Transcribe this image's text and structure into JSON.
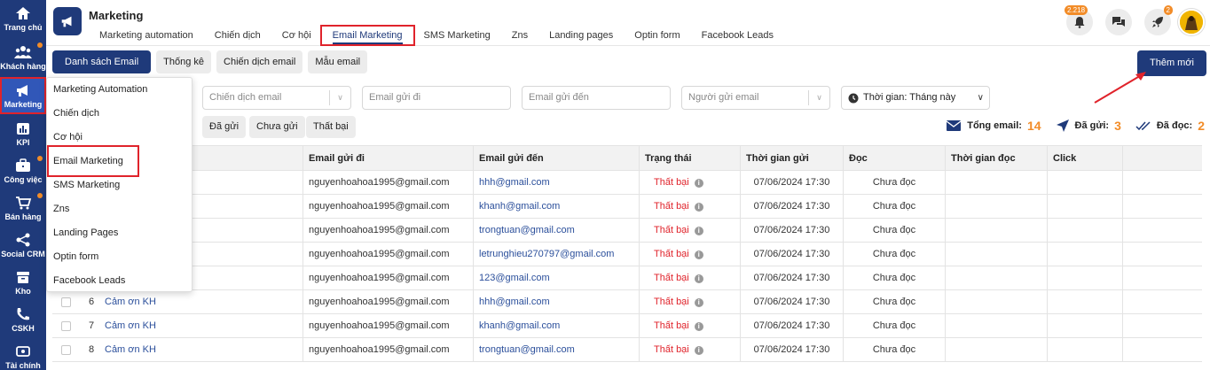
{
  "sidebar": {
    "items": [
      {
        "label": "Trang chủ",
        "icon": "home-icon"
      },
      {
        "label": "Khách hàng",
        "icon": "users-icon",
        "dot": true
      },
      {
        "label": "Marketing",
        "icon": "megaphone-icon",
        "active": true
      },
      {
        "label": "KPI",
        "icon": "chart-icon"
      },
      {
        "label": "Công việc",
        "icon": "briefcase-icon",
        "dot": true
      },
      {
        "label": "Bán hàng",
        "icon": "cart-icon",
        "dot": true
      },
      {
        "label": "Social CRM",
        "icon": "share-icon"
      },
      {
        "label": "Kho",
        "icon": "box-icon"
      },
      {
        "label": "CSKH",
        "icon": "phone-icon"
      },
      {
        "label": "Tài chính",
        "icon": "finance-icon"
      }
    ]
  },
  "header": {
    "title": "Marketing",
    "tabs": [
      "Marketing automation",
      "Chiến dịch",
      "Cơ hội",
      "Email Marketing",
      "SMS Marketing",
      "Zns",
      "Landing pages",
      "Optin form",
      "Facebook Leads"
    ],
    "active_tab": "Email Marketing",
    "notification_count": "2.218",
    "rocket_badge": "2"
  },
  "subtabs": [
    "Danh sách Email",
    "Thống kê",
    "Chiến dịch email",
    "Mẫu email"
  ],
  "add_button": "Thêm mới",
  "filters": {
    "campaign_placeholder": "Chiến dịch email",
    "from_placeholder": "Email gửi đi",
    "to_placeholder": "Email gửi đến",
    "sender_placeholder": "Người gửi email",
    "time_value": "Thời gian: Tháng này"
  },
  "status_chips": [
    "Đã gửi",
    "Chưa gửi",
    "Thất bại"
  ],
  "summary": {
    "total_label": "Tổng email:",
    "total": "14",
    "sent_label": "Đã gửi:",
    "sent": "3",
    "read_label": "Đã đọc:",
    "read": "2"
  },
  "dropdown_menu": [
    "Marketing Automation",
    "Chiến dịch",
    "Cơ hội",
    "Email Marketing",
    "SMS Marketing",
    "Zns",
    "Landing Pages",
    "Optin form",
    "Facebook Leads"
  ],
  "table": {
    "columns": [
      "Email gửi đi",
      "Email gửi đến",
      "Trạng thái",
      "Thời gian gửi",
      "Đọc",
      "Thời gian đọc",
      "Click"
    ],
    "rows": [
      {
        "idx": "",
        "name": "",
        "from": "nguyenhoahoa1995@gmail.com",
        "to": "hhh@gmail.com",
        "status": "Thất bại",
        "sent_time": "07/06/2024 17:30",
        "read": "Chưa đọc"
      },
      {
        "idx": "",
        "name": "",
        "from": "nguyenhoahoa1995@gmail.com",
        "to": "khanh@gmail.com",
        "status": "Thất bại",
        "sent_time": "07/06/2024 17:30",
        "read": "Chưa đọc"
      },
      {
        "idx": "",
        "name": "",
        "from": "nguyenhoahoa1995@gmail.com",
        "to": "trongtuan@gmail.com",
        "status": "Thất bại",
        "sent_time": "07/06/2024 17:30",
        "read": "Chưa đọc"
      },
      {
        "idx": "",
        "name": "",
        "from": "nguyenhoahoa1995@gmail.com",
        "to": "letrunghieu270797@gmail.com",
        "status": "Thất bại",
        "sent_time": "07/06/2024 17:30",
        "read": "Chưa đọc"
      },
      {
        "idx": "",
        "name": "",
        "from": "nguyenhoahoa1995@gmail.com",
        "to": "123@gmail.com",
        "status": "Thất bại",
        "sent_time": "07/06/2024 17:30",
        "read": "Chưa đọc"
      },
      {
        "idx": "6",
        "name": "Cảm ơn KH",
        "from": "nguyenhoahoa1995@gmail.com",
        "to": "hhh@gmail.com",
        "status": "Thất bại",
        "sent_time": "07/06/2024 17:30",
        "read": "Chưa đọc"
      },
      {
        "idx": "7",
        "name": "Cảm ơn KH",
        "from": "nguyenhoahoa1995@gmail.com",
        "to": "khanh@gmail.com",
        "status": "Thất bại",
        "sent_time": "07/06/2024 17:30",
        "read": "Chưa đọc"
      },
      {
        "idx": "8",
        "name": "Cảm ơn KH",
        "from": "nguyenhoahoa1995@gmail.com",
        "to": "trongtuan@gmail.com",
        "status": "Thất bại",
        "sent_time": "07/06/2024 17:30",
        "read": "Chưa đọc"
      }
    ]
  }
}
